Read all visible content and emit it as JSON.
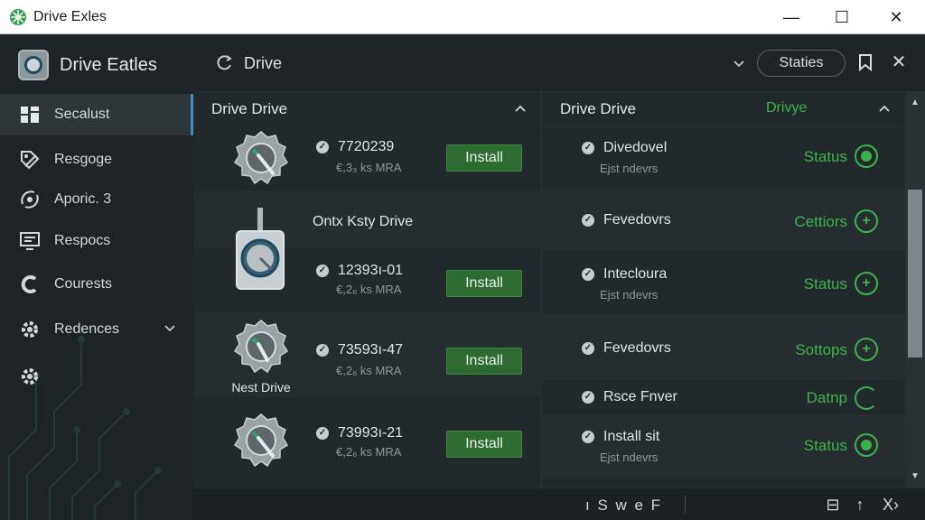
{
  "window": {
    "title": "Drive Exles",
    "minimize": "—",
    "maximize": "☐",
    "close": "✕"
  },
  "sidebar": {
    "brand": "Drive Eatles",
    "items": [
      {
        "label": "Secalust",
        "icon": "grid-icon",
        "active": true
      },
      {
        "label": "Resgoge",
        "icon": "tag-icon"
      },
      {
        "label": "Aporic. 3",
        "icon": "satellite-icon"
      },
      {
        "label": "Respocs",
        "icon": "monitor-icon"
      },
      {
        "label": "Courests",
        "icon": "cycle-icon"
      },
      {
        "label": "Redences",
        "icon": "gear-icon",
        "has_chevron": true
      },
      {
        "label": "",
        "icon": "settings-gear-icon"
      }
    ]
  },
  "toolbar": {
    "title": "Drive",
    "status_button": "Staties",
    "close_glyph": "✕"
  },
  "left_panel": {
    "header": "Drive Drive",
    "rows": [
      {
        "id": "7720239",
        "size": "€,3₃ ks MRA",
        "button": "Install"
      },
      {
        "title": "Ontx Ksty Drive"
      },
      {
        "id": "12393ı-01",
        "size": "€,2₆ ks MRA",
        "button": "Install"
      },
      {
        "name": "Nest Drive",
        "id": "73593ı-47",
        "size": "€,2₆ ks MRA",
        "button": "Install"
      },
      {
        "id": "73993ı-21",
        "size": "€,2₆ ks MRA",
        "button": "Install"
      }
    ]
  },
  "right_panel": {
    "header": "Drive Drive",
    "header_accent": "Drivye",
    "rows": [
      {
        "title": "Divedovel",
        "sub": "Ejst ndevrs",
        "status": "Status",
        "indicator": "filled"
      },
      {
        "title": "Fevedovrs",
        "sub": "",
        "status": "Cettiors",
        "indicator": "plus"
      },
      {
        "title": "Intecloura",
        "sub": "Ejst ndevrs",
        "status": "Status",
        "indicator": "plus"
      },
      {
        "title": "Fevedovrs",
        "sub": "",
        "status": "Sottops",
        "indicator": "plus"
      },
      {
        "title": "Rsce Fnver",
        "sub": "",
        "status": "Datnp",
        "indicator": "open"
      },
      {
        "title": "Install sit",
        "sub": "Ejst ndevrs",
        "status": "Status",
        "indicator": "filled"
      }
    ]
  },
  "bottombar": {
    "text": "ı S w e F",
    "btn1": "⊟",
    "btn2": "↑",
    "btn3": "X›"
  },
  "colors": {
    "accent_green": "#3cb34a",
    "install_green": "#2e6b32",
    "active_blue": "#3b8fc4",
    "background": "#1e2427"
  }
}
